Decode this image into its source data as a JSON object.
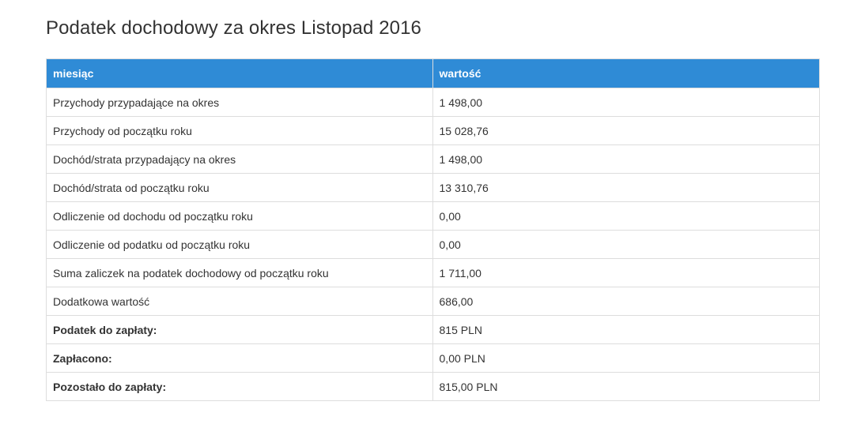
{
  "page": {
    "title": "Podatek dochodowy za okres Listopad 2016"
  },
  "table": {
    "headers": [
      "miesiąc",
      "wartość"
    ],
    "rows": [
      {
        "label": "Przychody przypadające na okres",
        "value": "1 498,00"
      },
      {
        "label": "Przychody od początku roku",
        "value": "15 028,76"
      },
      {
        "label": "Dochód/strata przypadający na okres",
        "value": "1 498,00"
      },
      {
        "label": "Dochód/strata od początku roku",
        "value": "13 310,76"
      },
      {
        "label": "Odliczenie od dochodu od początku roku",
        "value": "0,00"
      },
      {
        "label": "Odliczenie od podatku od początku roku",
        "value": "0,00"
      },
      {
        "label": "Suma zaliczek na podatek dochodowy od początku roku",
        "value": "1 711,00"
      },
      {
        "label": "Dodatkowa wartość",
        "value": "686,00"
      },
      {
        "label": "Podatek do zapłaty:",
        "value": "815 PLN"
      },
      {
        "label": "Zapłacono:",
        "value": "0,00 PLN"
      },
      {
        "label": "Pozostało do zapłaty:",
        "value": "815,00 PLN"
      }
    ]
  },
  "colors": {
    "header_bg": "#2f8bd6",
    "header_text": "#ffffff",
    "border": "#dddddd",
    "text": "#333333"
  }
}
